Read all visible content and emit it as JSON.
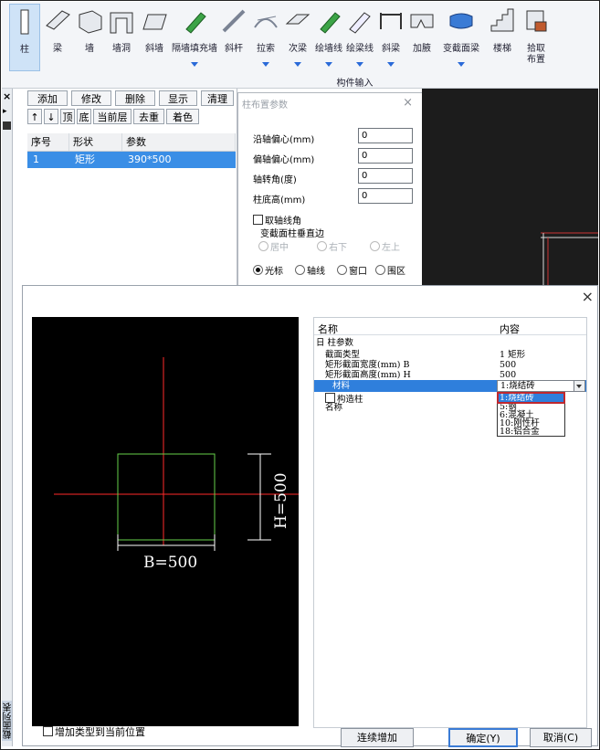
{
  "ribbon": {
    "buttons": [
      {
        "label": "柱",
        "icon": "column-icon"
      },
      {
        "label": "梁",
        "icon": "beam-icon"
      },
      {
        "label": "墙",
        "icon": "wall-icon"
      },
      {
        "label": "墙洞",
        "icon": "wall-opening-icon"
      },
      {
        "label": "斜墙",
        "icon": "slant-wall-icon"
      },
      {
        "label": "隔墙填充墙",
        "icon": "partition-wall-icon"
      },
      {
        "label": "斜杆",
        "icon": "brace-icon"
      },
      {
        "label": "拉索",
        "icon": "cable-icon"
      },
      {
        "label": "次梁",
        "icon": "secondary-beam-icon"
      },
      {
        "label": "绘墙线",
        "icon": "draw-wall-line-icon"
      },
      {
        "label": "绘梁线",
        "icon": "draw-beam-line-icon"
      },
      {
        "label": "斜梁",
        "icon": "slant-beam-icon"
      },
      {
        "label": "加腋",
        "icon": "haunch-icon"
      },
      {
        "label": "变截面梁",
        "icon": "variable-beam-icon"
      },
      {
        "label": "楼梯",
        "icon": "stair-icon"
      },
      {
        "label": "拾取",
        "label2": "布置",
        "icon": "pick-layout-icon"
      }
    ],
    "group_label": "构件输入"
  },
  "section_panel": {
    "toolbar1": [
      "添加",
      "修改",
      "删除",
      "显示",
      "清理"
    ],
    "toolbar2": [
      "↑",
      "↓",
      "顶",
      "底",
      "当前层",
      "去重",
      "着色"
    ],
    "columns": [
      "序号",
      "形状",
      "参数"
    ],
    "rows": [
      {
        "index": "1",
        "shape": "矩形",
        "params": "390*500"
      }
    ],
    "vertical_label": "截面列表"
  },
  "params_dialog": {
    "title": "柱布置参数",
    "fields": [
      {
        "label": "沿轴偏心(mm)",
        "value": "0"
      },
      {
        "label": "偏轴偏心(mm)",
        "value": "0"
      },
      {
        "label": "轴转角(度)",
        "value": "0"
      },
      {
        "label": "柱底高(mm)",
        "value": "0"
      }
    ],
    "take_axis_angle": "取轴线角",
    "variable_section_title": "变截面柱垂直边",
    "variable_section_options": [
      "居中",
      "右下",
      "左上"
    ],
    "placement_modes": [
      "光标",
      "轴线",
      "窗口",
      "围区"
    ]
  },
  "main_dialog": {
    "preview": {
      "b_label": "B=500",
      "h_label": "H=500"
    },
    "prop_header": {
      "name": "名称",
      "content": "内容"
    },
    "group": "日 柱参数",
    "props": [
      {
        "key": "截面类型",
        "value": "1   矩形"
      },
      {
        "key": "矩形截面宽度(mm) B",
        "value": "500"
      },
      {
        "key": "矩形截面高度(mm) H",
        "value": "500"
      },
      {
        "key": "材料",
        "value": "1:烧结砖"
      },
      {
        "key": "构造柱",
        "value": ""
      },
      {
        "key": "名称",
        "value": ""
      }
    ],
    "material_options": [
      "1:烧结砖",
      "5:钢",
      "6:混凝土",
      "10:刚性杆",
      "18:铝合金"
    ],
    "add_to_position": "增加类型到当前位置",
    "buttons": {
      "continue": "连续增加",
      "ok": "确定(Y)",
      "cancel": "取消(C)"
    },
    "close_icon": "×"
  },
  "colors": {
    "accent": "#2f7fdc",
    "rect_stroke": "#66d04a",
    "axis": "#ff2a2a",
    "dim": "#ffffff",
    "dropdown_highlight_border": "#c0282e"
  }
}
